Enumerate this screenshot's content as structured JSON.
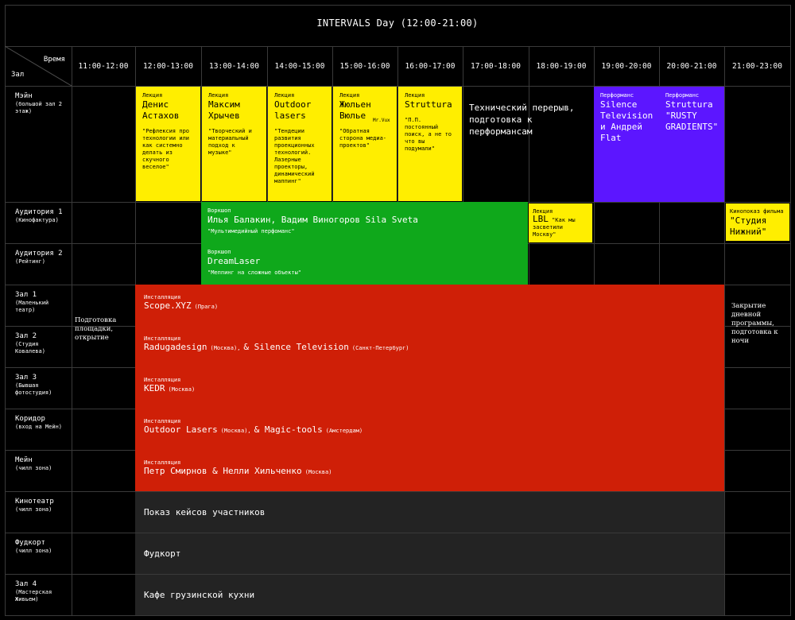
{
  "title": "INTERVALS Day (12:00-21:00)",
  "corner": {
    "time": "Время",
    "hall": "Зал"
  },
  "times": [
    "11:00-12:00",
    "12:00-13:00",
    "13:00-14:00",
    "14:00-15:00",
    "15:00-16:00",
    "16:00-17:00",
    "17:00-18:00",
    "18:00-19:00",
    "19:00-20:00",
    "20:00-21:00",
    "21:00-23:00"
  ],
  "rooms": [
    {
      "name": "Мэйн",
      "sub": "(большой зал 2 этаж)"
    },
    {
      "name": "Аудитория 1",
      "sub": "(Кинофактура)"
    },
    {
      "name": "Аудитория 2",
      "sub": "(Рейтинг)"
    },
    {
      "name": "Зал 1",
      "sub": "(Маленький театр)"
    },
    {
      "name": "Зал 2",
      "sub": "(Студия Ковалева)"
    },
    {
      "name": "Зал 3",
      "sub": "(Бывшая фотостудия)"
    },
    {
      "name": "Коридор",
      "sub": "(вход на Мейн)"
    },
    {
      "name": "Мейн",
      "sub": "(чилл зона)"
    },
    {
      "name": "Кинотеатр",
      "sub": "(чилл зона)"
    },
    {
      "name": "Фудкорт",
      "sub": "(чилл зона)"
    },
    {
      "name": "Зал 4",
      "sub": "(Мастерская Живьем)"
    }
  ],
  "prep": "Подготовка площадки, открытие",
  "closing": "Закрытие дневной программы, подготовка к ночи",
  "lectures": [
    {
      "kind": "Лекция",
      "name": "Денис Астахов",
      "desc": "\"Рефлексия про технологии или как системно делать из скучного веселое\""
    },
    {
      "kind": "Лекция",
      "name": "Максим Хрычев",
      "desc": "\"Творческий и материальный подход к музыке\""
    },
    {
      "kind": "Лекция",
      "name": "Outdoor lasers",
      "desc": "\"Тендеции развития проекционных технологий. Лазерные проекторы, динамический маппинг\""
    },
    {
      "kind": "Лекция",
      "name": "Жюльен Вюлье",
      "note": "Mr.Vux",
      "desc": "\"Обратная сторона медиа-проектов\""
    },
    {
      "kind": "Лекция",
      "name": "Struttura",
      "desc": "\"П.П. постоянный поиск, а не то что вы подумали\""
    }
  ],
  "break": "Технический перерыв, подготовка к перформансам",
  "performances": [
    {
      "kind": "Перформанс",
      "name": "Silence Television и Андрей Flat"
    },
    {
      "kind": "Перформанс",
      "name": "Struttura \"RUSTY GRADIENTS\""
    }
  ],
  "workshops": [
    {
      "kind": "Воркшоп",
      "name": "Илья Балакин, Вадим Виногоров Sila Sveta",
      "desc": "\"Мультимедийный перфоманс\""
    },
    {
      "kind": "Воркшоп",
      "name": "DreamLaser",
      "desc": "\"Меппинг на сложные объекты\""
    }
  ],
  "lbl": {
    "kind": "Лекция",
    "name": "LBL",
    "desc": "\"Как мы засветили Москву\""
  },
  "film": {
    "kind": "Кинопоказ фильма",
    "name": "\"Студия Нижний\""
  },
  "installations": [
    {
      "kind": "Инсталляция",
      "name": "Scope.XYZ",
      "loc": "(Прага)",
      "name2": "",
      "loc2": ""
    },
    {
      "kind": "Инсталляция",
      "name": "Radugadesign",
      "loc": "(Москва),",
      "name2": "& Silence Television",
      "loc2": "(Санкт-Петербург)"
    },
    {
      "kind": "Инсталляция",
      "name": "KEDR",
      "loc": "(Москва)",
      "name2": "",
      "loc2": ""
    },
    {
      "kind": "Инсталляция",
      "name": "Outdoor Lasers",
      "loc": "(Москва),",
      "name2": "& Magic-tools",
      "loc2": "(Амстердам)"
    },
    {
      "kind": "Инсталляция",
      "name": "Петр Смирнов & Нелли Хильченко",
      "loc": "(Москва)",
      "name2": "",
      "loc2": ""
    }
  ],
  "chill": [
    "Показ кейсов участников",
    "Фудкорт",
    "Кафе грузинской кухни"
  ]
}
